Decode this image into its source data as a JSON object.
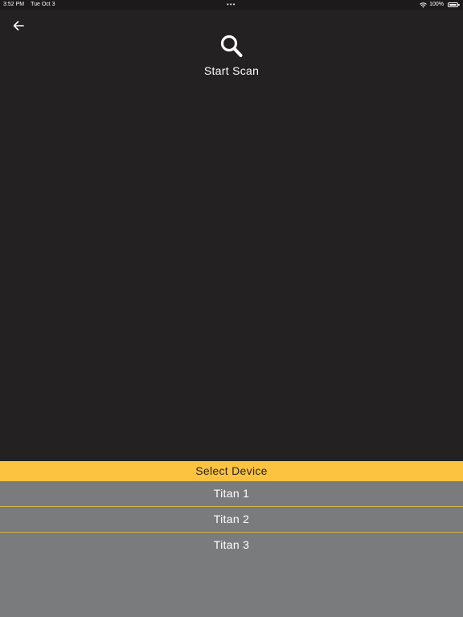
{
  "status_bar": {
    "time": "3:52 PM",
    "date": "Tue Oct 3",
    "multitask_dots": "•••",
    "battery_percent": "100%",
    "battery_level": 1.0,
    "icons": [
      "wifi-icon",
      "battery-icon"
    ]
  },
  "nav": {
    "back_icon": "arrow-left-icon"
  },
  "scan": {
    "icon": "search-icon",
    "label": "Start Scan"
  },
  "device_panel": {
    "title": "Select Device",
    "items": [
      {
        "label": "Titan 1"
      },
      {
        "label": "Titan 2"
      },
      {
        "label": "Titan 3"
      }
    ]
  },
  "colors": {
    "background": "#242122",
    "header_accent": "#fbc33f",
    "list_background": "#7a7b7d",
    "divider": "#d2b24a"
  }
}
